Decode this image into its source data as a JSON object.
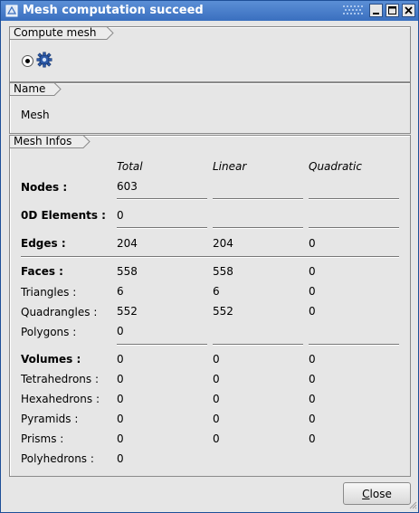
{
  "window": {
    "title": "Mesh computation succeed"
  },
  "compute_group": {
    "label": "Compute mesh"
  },
  "name_group": {
    "label": "Name",
    "value": "Mesh"
  },
  "info_group": {
    "label": "Mesh Infos",
    "headers": {
      "total": "Total",
      "linear": "Linear",
      "quadratic": "Quadratic"
    },
    "nodes": {
      "label": "Nodes :",
      "total": "603"
    },
    "elements0d": {
      "label": "0D Elements :",
      "total": "0"
    },
    "edges": {
      "label": "Edges :",
      "total": "204",
      "linear": "204",
      "quadratic": "0"
    },
    "faces": {
      "label": "Faces :",
      "total": "558",
      "linear": "558",
      "quadratic": "0"
    },
    "triangles": {
      "label": "Triangles :",
      "total": "6",
      "linear": "6",
      "quadratic": "0"
    },
    "quadrangles": {
      "label": "Quadrangles :",
      "total": "552",
      "linear": "552",
      "quadratic": "0"
    },
    "polygons": {
      "label": "Polygons :",
      "total": "0"
    },
    "volumes": {
      "label": "Volumes :",
      "total": "0",
      "linear": "0",
      "quadratic": "0"
    },
    "tetrahedrons": {
      "label": "Tetrahedrons :",
      "total": "0",
      "linear": "0",
      "quadratic": "0"
    },
    "hexahedrons": {
      "label": "Hexahedrons :",
      "total": "0",
      "linear": "0",
      "quadratic": "0"
    },
    "pyramids": {
      "label": "Pyramids :",
      "total": "0",
      "linear": "0",
      "quadratic": "0"
    },
    "prisms": {
      "label": "Prisms :",
      "total": "0",
      "linear": "0",
      "quadratic": "0"
    },
    "polyhedrons": {
      "label": "Polyhedrons :",
      "total": "0"
    }
  },
  "buttons": {
    "close_mnemonic": "C",
    "close_rest": "lose"
  },
  "colors": {
    "titlebar": "#3a6fbf",
    "border": "#1e4f98"
  }
}
